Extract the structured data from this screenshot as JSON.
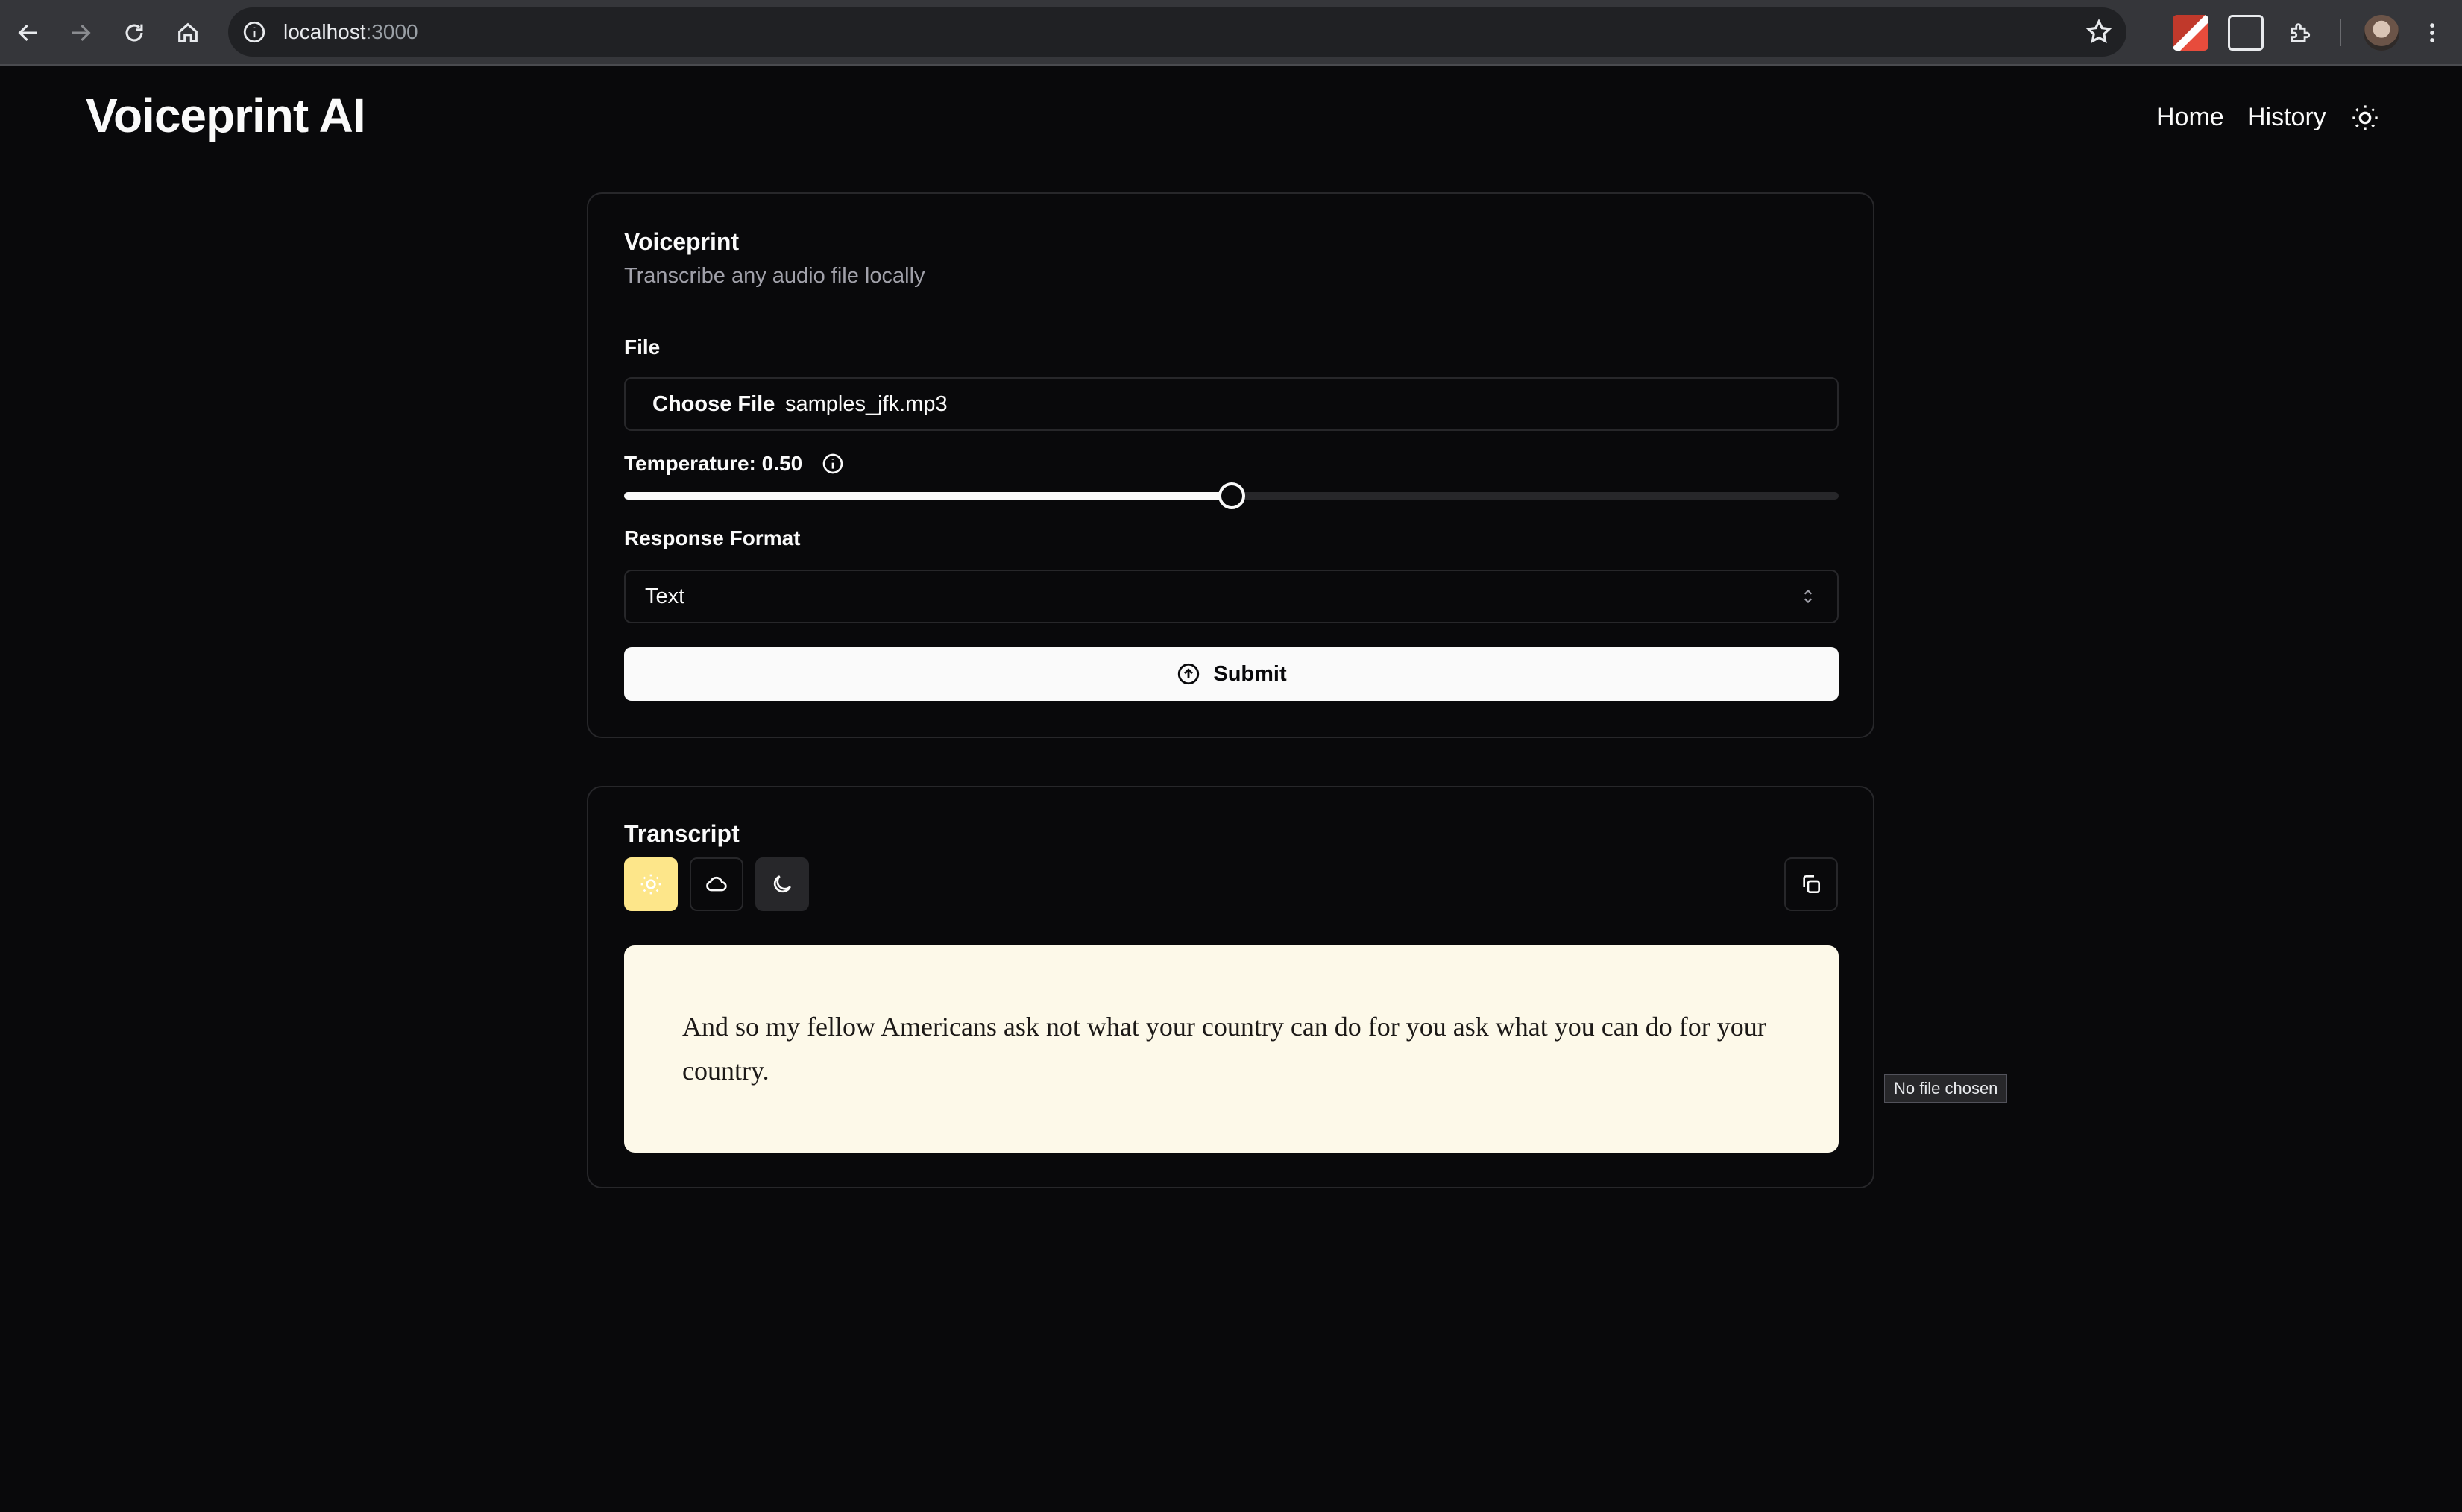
{
  "browser": {
    "url_host": "localhost",
    "url_port": ":3000"
  },
  "app": {
    "brand": "Voiceprint AI",
    "nav": {
      "home": "Home",
      "history": "History"
    }
  },
  "form_card": {
    "title": "Voiceprint",
    "description": "Transcribe any audio file locally",
    "file_label": "File",
    "file_button": "Choose File",
    "file_name": "samples_jfk.mp3",
    "temperature_label": "Temperature: 0.50",
    "temperature_value": 0.5,
    "response_format_label": "Response Format",
    "response_format_value": "Text",
    "submit_label": "Submit"
  },
  "transcript_card": {
    "title": "Transcript",
    "text": "And so my fellow Americans ask not what your country can do for you ask what you can do for your country."
  },
  "tooltip": "No file chosen",
  "colors": {
    "background": "#09090b",
    "border": "#27272a",
    "light_theme_accent": "#fde68a",
    "transcript_bg": "#fdf9e9"
  }
}
